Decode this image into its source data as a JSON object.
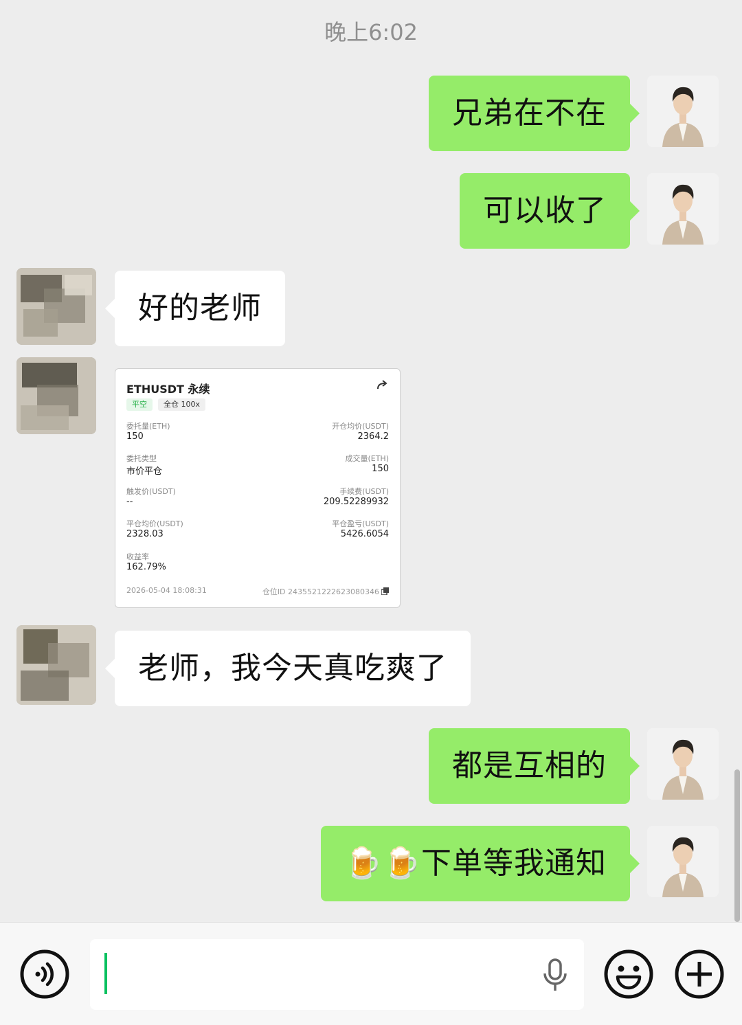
{
  "chat": {
    "timestamp": "晚上6:02",
    "messages": [
      {
        "side": "self",
        "text": "兄弟在不在"
      },
      {
        "side": "self",
        "text": "可以收了"
      },
      {
        "side": "other",
        "text": "好的老师"
      },
      {
        "side": "other",
        "type": "card"
      },
      {
        "side": "other",
        "text": "老师，我今天真吃爽了"
      },
      {
        "side": "self",
        "text": "都是互相的"
      },
      {
        "side": "self",
        "text": "🍺🍺下单等我通知"
      }
    ]
  },
  "card": {
    "title": "ETHUSDT 永续",
    "tag_side": "平空",
    "tag_margin": "全仓 100x",
    "order_qty_label": "委托量(ETH)",
    "order_qty": "150",
    "open_avg_label": "开仓均价(USDT)",
    "open_avg": "2364.2",
    "order_type_label": "委托类型",
    "order_type": "市价平仓",
    "filled_qty_label": "成交量(ETH)",
    "filled_qty": "150",
    "trigger_label": "触发价(USDT)",
    "trigger": "--",
    "fee_label": "手续费(USDT)",
    "fee": "209.52289932",
    "close_avg_label": "平仓均价(USDT)",
    "close_avg": "2328.03",
    "pnl_label": "平仓盈亏(USDT)",
    "pnl": "5426.6054",
    "roi_label": "收益率",
    "roi": "162.79%",
    "time": "2026-05-04 18:08:31",
    "position_id": "仓位ID 2435521222623080346"
  },
  "icons": {
    "voice": "voice-icon",
    "mic": "microphone-icon",
    "emoji": "emoji-icon",
    "plus": "plus-icon",
    "share": "share-icon",
    "copy": "copy-icon"
  },
  "colors": {
    "self_bubble": "#95ec69",
    "other_bubble": "#ffffff",
    "background": "#ededed",
    "caret": "#07c160"
  }
}
